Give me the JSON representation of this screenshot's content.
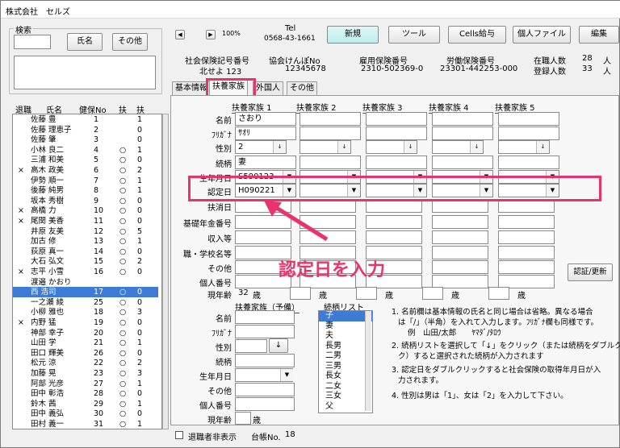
{
  "window": {
    "title": "株式会社　セルズ"
  },
  "search": {
    "label": "検索",
    "value": "",
    "name_button": "氏名",
    "other_button": "その他"
  },
  "list": {
    "headers": [
      "退職",
      "氏名",
      "健保No",
      "扶",
      "扶"
    ],
    "rows": [
      {
        "retired": "",
        "name": "佐藤 豊",
        "no": "1",
        "flag": "",
        "dep": "1"
      },
      {
        "retired": "",
        "name": "佐藤 理恵子",
        "no": "2",
        "flag": "",
        "dep": "0"
      },
      {
        "retired": "",
        "name": "佐藤 肇",
        "no": "3",
        "flag": "",
        "dep": "0"
      },
      {
        "retired": "",
        "name": "小林 良二",
        "no": "4",
        "flag": "○",
        "dep": "1"
      },
      {
        "retired": "",
        "name": "三浦 和美",
        "no": "5",
        "flag": "○",
        "dep": "0"
      },
      {
        "retired": "×",
        "name": "高木 政美",
        "no": "6",
        "flag": "○",
        "dep": "2"
      },
      {
        "retired": "",
        "name": "伊勢 順一",
        "no": "7",
        "flag": "○",
        "dep": "1"
      },
      {
        "retired": "",
        "name": "後藤 純男",
        "no": "8",
        "flag": "○",
        "dep": "1"
      },
      {
        "retired": "",
        "name": "坂本 秀樹",
        "no": "9",
        "flag": "○",
        "dep": "0"
      },
      {
        "retired": "×",
        "name": "高橋 力",
        "no": "10",
        "flag": "○",
        "dep": "0"
      },
      {
        "retired": "×",
        "name": "尾関 美香",
        "no": "11",
        "flag": "○",
        "dep": "0"
      },
      {
        "retired": "",
        "name": "井原 友美",
        "no": "12",
        "flag": "○",
        "dep": "5"
      },
      {
        "retired": "",
        "name": "加古 修",
        "no": "13",
        "flag": "○",
        "dep": "1"
      },
      {
        "retired": "",
        "name": "荻原 真一",
        "no": "14",
        "flag": "○",
        "dep": "0"
      },
      {
        "retired": "",
        "name": "大石 弘文",
        "no": "15",
        "flag": "○",
        "dep": "2"
      },
      {
        "retired": "×",
        "name": "志平 小雪",
        "no": "16",
        "flag": "○",
        "dep": "0"
      },
      {
        "retired": "",
        "name": "渡邉 かおり",
        "no": "",
        "flag": "",
        "dep": ""
      },
      {
        "retired": "",
        "name": "西 浩司",
        "no": "17",
        "flag": "○",
        "dep": "0"
      },
      {
        "retired": "",
        "name": "一之瀬 綾",
        "no": "25",
        "flag": "○",
        "dep": "0"
      },
      {
        "retired": "",
        "name": "小柳 雅也",
        "no": "18",
        "flag": "○",
        "dep": "3"
      },
      {
        "retired": "×",
        "name": "内野 猛",
        "no": "19",
        "flag": "○",
        "dep": "0"
      },
      {
        "retired": "",
        "name": "神部 幸子",
        "no": "20",
        "flag": "○",
        "dep": "0"
      },
      {
        "retired": "",
        "name": "山田 学",
        "no": "21",
        "flag": "○",
        "dep": "1"
      },
      {
        "retired": "",
        "name": "田口 輝美",
        "no": "26",
        "flag": "○",
        "dep": "0"
      },
      {
        "retired": "",
        "name": "松元 涼",
        "no": "22",
        "flag": "○",
        "dep": "2"
      },
      {
        "retired": "",
        "name": "加藤 晃",
        "no": "23",
        "flag": "○",
        "dep": "3"
      },
      {
        "retired": "",
        "name": "阿部 光彦",
        "no": "27",
        "flag": "○",
        "dep": "1"
      },
      {
        "retired": "",
        "name": "田中 彰浩",
        "no": "28",
        "flag": "○",
        "dep": "0"
      },
      {
        "retired": "",
        "name": "鈴木 茜",
        "no": "29",
        "flag": "○",
        "dep": "1"
      },
      {
        "retired": "",
        "name": "田中 義弘",
        "no": "30",
        "flag": "○",
        "dep": "0"
      },
      {
        "retired": "",
        "name": "田村 義一",
        "no": "31",
        "flag": "○",
        "dep": "1"
      }
    ],
    "selected_index": 17
  },
  "toolbar": {
    "zoom": "100%",
    "tel_label": "Tel",
    "tel": "0568-43-1661",
    "new": "新規",
    "tool": "ツール",
    "cells": "Cells給与",
    "file": "個人ファイル",
    "edit": "編集"
  },
  "info": {
    "social_label": "社会保険記号番号",
    "social_value": "北せよ 123",
    "kyokai_label": "協会けんぽNo",
    "kyokai_value": "12345678",
    "koyou_label": "雇用保険番号",
    "koyou_value": "2310-502369-0",
    "roudou_label": "労働保険番号",
    "roudou_value": "23301-442253-000",
    "zaishoku_label": "在職人数",
    "zaishoku_value": "28",
    "zaishoku_unit": "人",
    "touroku_label": "登録人数",
    "touroku_value": "33",
    "touroku_unit": "人"
  },
  "tabs": [
    "基本情報",
    "扶養家族",
    "外国人",
    "その他"
  ],
  "dep": {
    "columns": [
      "扶養家族 1",
      "扶養家族 2",
      "扶養家族 3",
      "扶養家族 4",
      "扶養家族 5"
    ],
    "labels": [
      "名前",
      "ﾌﾘｶﾞﾅ",
      "性別",
      "続柄",
      "生年月日",
      "認定日",
      "扶消日",
      "基礎年金番号",
      "収入等",
      "職・学校名等",
      "その他",
      "個人番号",
      "現年齢"
    ],
    "d1": {
      "name": "さおり",
      "kana": "ｻｵﾘ",
      "sex": "2",
      "rel": "妻",
      "birth": "S590123",
      "nintei": "H090221",
      "age": "32",
      "age_unit": "歳"
    },
    "age_unit": "歳",
    "auth_button": "認証/更新"
  },
  "annotation": {
    "text": "認定日を入力",
    "color": "#e8336d"
  },
  "prep": {
    "title": "扶養家族（予備）",
    "labels": [
      "名前",
      "ﾌﾘｶﾞﾅ",
      "性別",
      "続柄",
      "生年月日",
      "その他",
      "個人番号",
      "現年齢"
    ],
    "age_unit": "歳"
  },
  "relation": {
    "title": "続柄リスト",
    "items": [
      "子",
      "妻",
      "夫",
      "長男",
      "二男",
      "三男",
      "長女",
      "二女",
      "三女",
      "父"
    ]
  },
  "notes": [
    "1. 名前欄は基本情報の氏名と同じ場合は省略。異なる場合",
    "は「/」（半角）を入れて入力します。ﾌﾘｶﾞﾅ欄も同様です。",
    "例　山田/太郎　　ﾔﾏﾀﾞ/ﾀﾛｳ",
    "2. 続柄リストを選択して「↓」をクリック（または続柄をダブルクリッ",
    "ク）すると選択された続柄が入力されます",
    "3. 認定日をダブルクリックすると社会保険の取得年月日が入",
    "力されます。",
    "4. 性別は男は「1」、女は「2」を入力して下さい。"
  ],
  "footer": {
    "hide_label": "退職者非表示",
    "ledger_label": "台帳No.",
    "ledger_value": "18"
  }
}
